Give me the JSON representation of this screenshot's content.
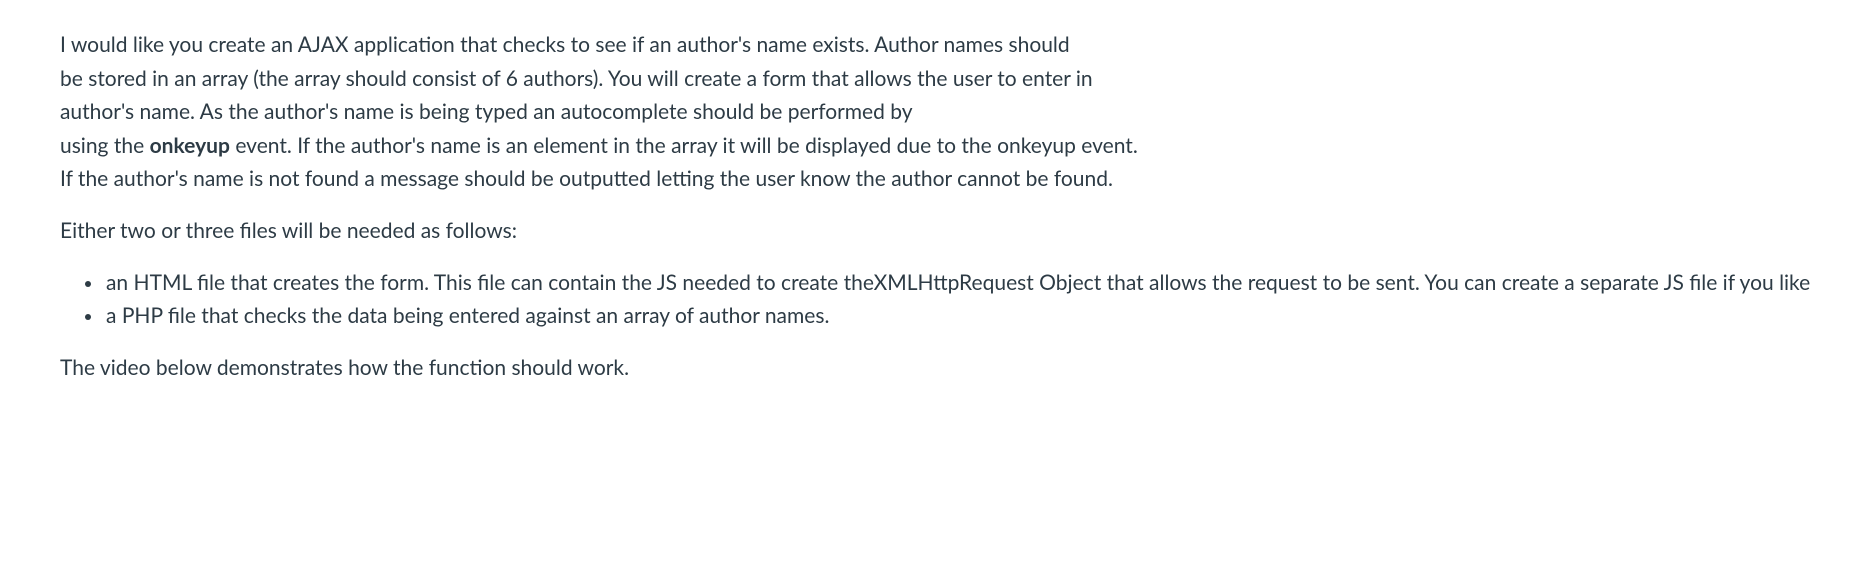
{
  "intro": {
    "line1": "I would like you create an AJAX application that checks to see if an author's name exists. Author names should",
    "line2": "be stored in an array (the array should consist of 6 authors).  You will create a form that allows the user to enter in",
    "line3": "author's name. As the author's name is being typed an autocomplete should be performed by",
    "line4a": "using the ",
    "line4_bold": "onkeyup",
    "line4b": " event.  If the author's name is an element in the array it will be displayed due to the onkeyup event.",
    "line5": " If the author's name is not found a message should be outputted letting the user know the author cannot be found."
  },
  "files_intro": "Either two or three files will be needed as follows:",
  "bullets": [
    "an HTML file that creates the form. This file can contain the JS needed to create theXMLHttpRequest Object that allows the request to be sent. You can create a separate JS file if you like",
    "a PHP file that checks the data being entered against an array of author names."
  ],
  "outro": "The video below demonstrates how the function should work."
}
